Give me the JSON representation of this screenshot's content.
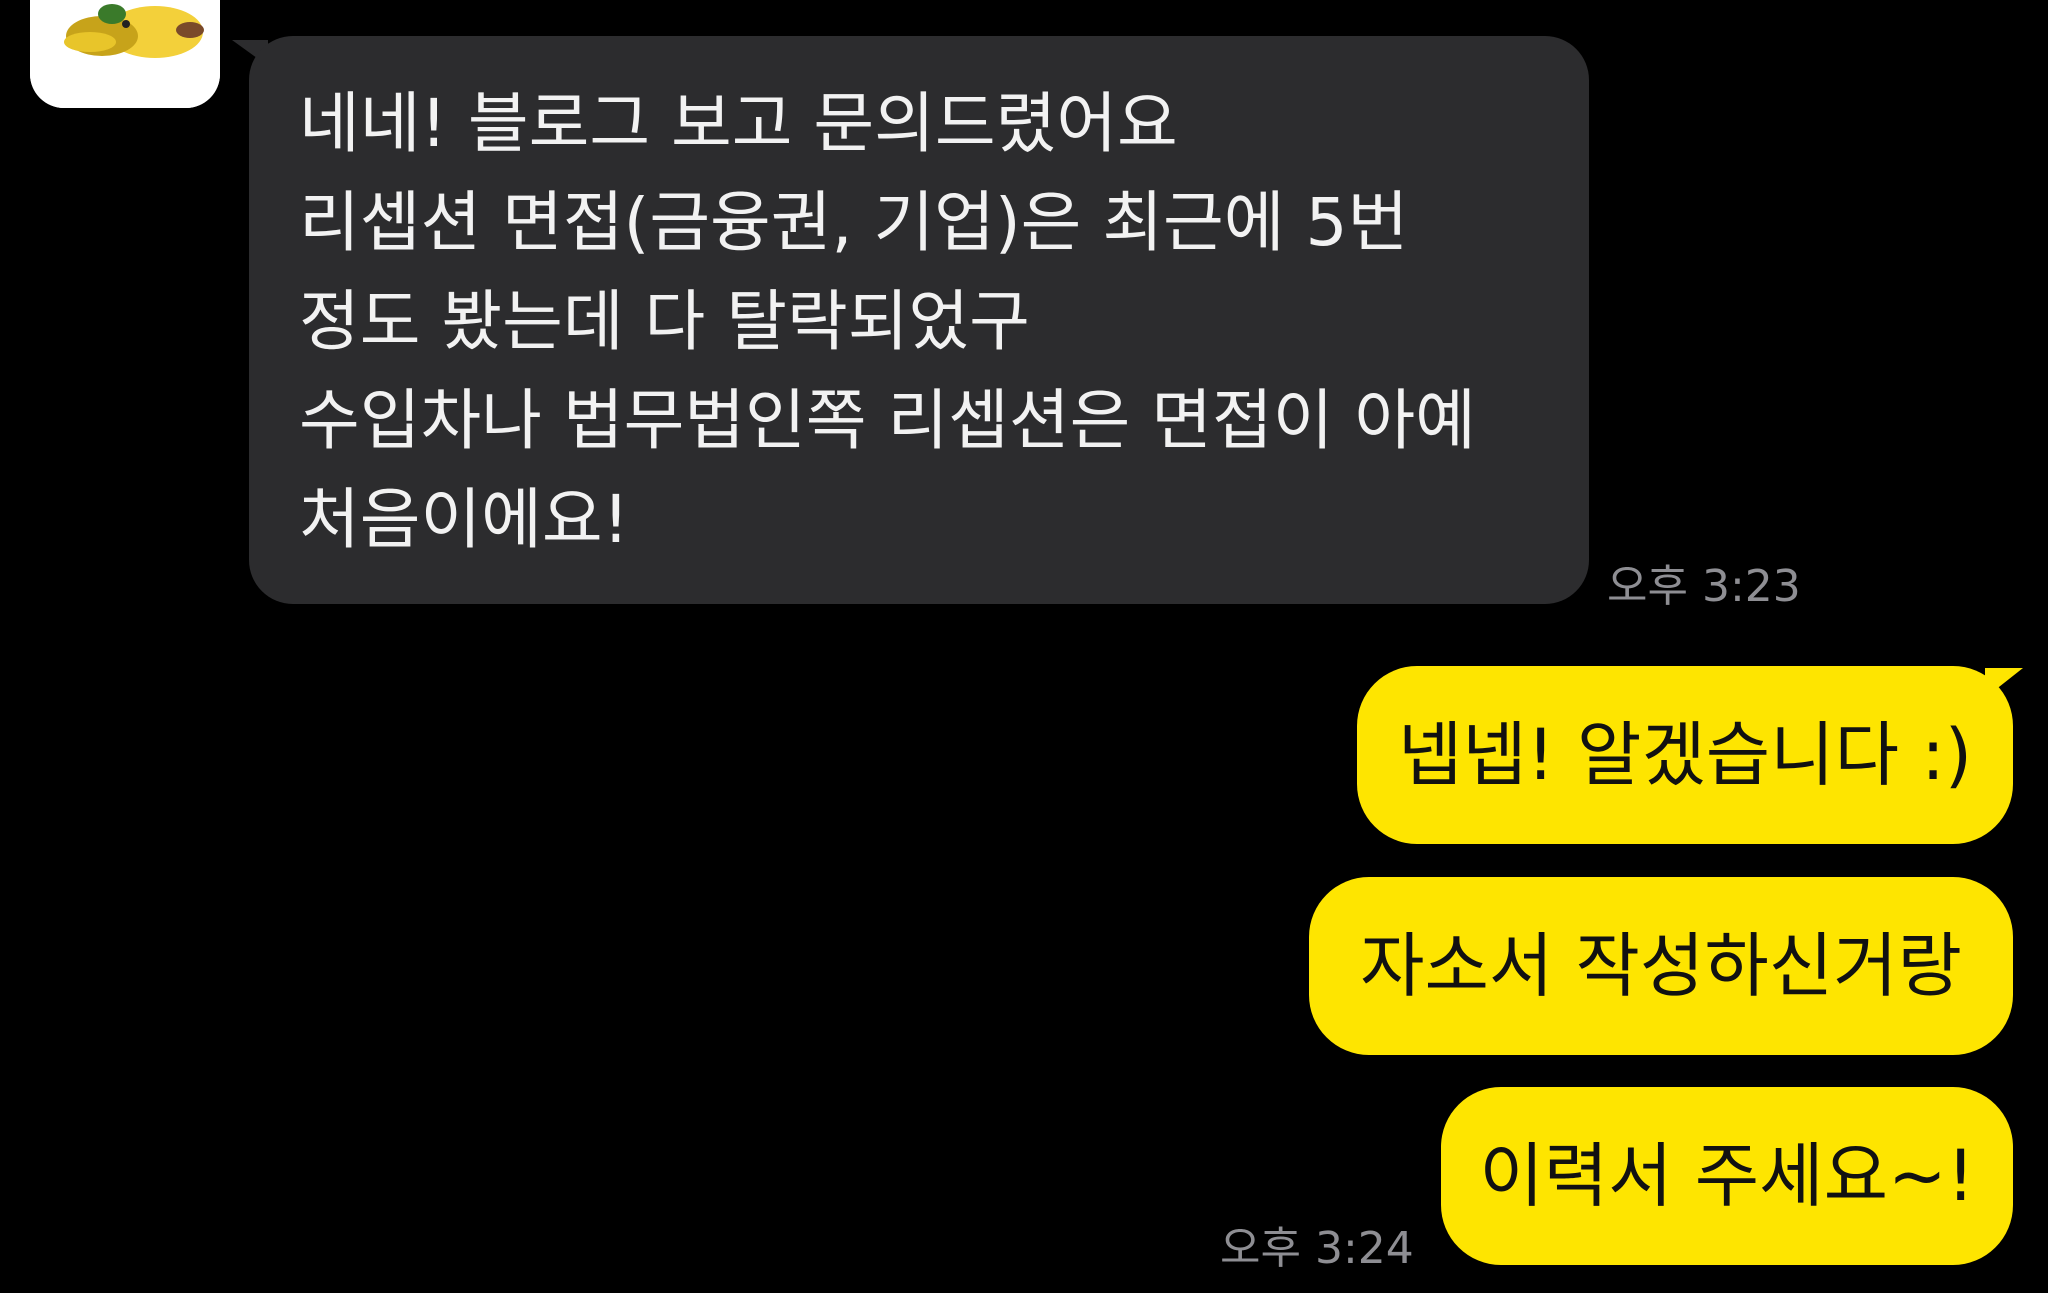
{
  "received": {
    "lines": [
      "네네! 블로그 보고 문의드렸어요",
      "리셉션 면접(금융권, 기업)은 최근에 5번",
      "정도 봤는데 다 탈락되었구",
      "수입차나 법무법인쪽 리셉션은 면접이 아예",
      "처음이에요!"
    ],
    "time": "오후 3:23"
  },
  "sent": {
    "messages": [
      "넵넵! 알겠습니다 :)",
      "자소서 작성하신거랑",
      "이력서 주세요~!"
    ],
    "time": "오후 3:24"
  },
  "colors": {
    "background": "#000000",
    "received_bubble": "#2c2c2e",
    "sent_bubble": "#fee500",
    "timestamp": "#8e8e93"
  },
  "icons": {
    "avatar": "profile-avatar-character"
  }
}
